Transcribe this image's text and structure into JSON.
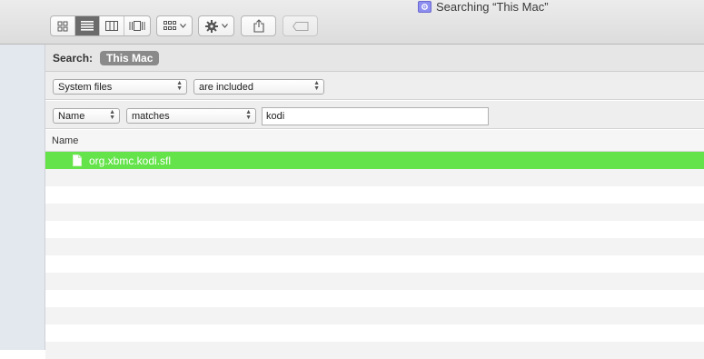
{
  "window": {
    "title": "Searching “This Mac”"
  },
  "toolbar": {
    "view_modes": [
      "icon-view",
      "list-view",
      "column-view",
      "cover-flow-view"
    ],
    "active_view": "list-view",
    "icons": {
      "arrange": "arrange-icon",
      "action": "gear-icon",
      "share": "share-icon",
      "tags": "tag-icon"
    }
  },
  "search": {
    "label": "Search:",
    "scope": "This Mac"
  },
  "criteria": [
    {
      "attribute": "System files",
      "operator": "are included"
    },
    {
      "attribute": "Name",
      "operator": "matches",
      "value": "kodi"
    }
  ],
  "list": {
    "columns": [
      "Name"
    ],
    "rows": [
      {
        "name": "org.xbmc.kodi.sfl",
        "selected": true
      }
    ]
  },
  "colors": {
    "selection": "#64e34a",
    "scope_pill": "#8a8a8a"
  }
}
